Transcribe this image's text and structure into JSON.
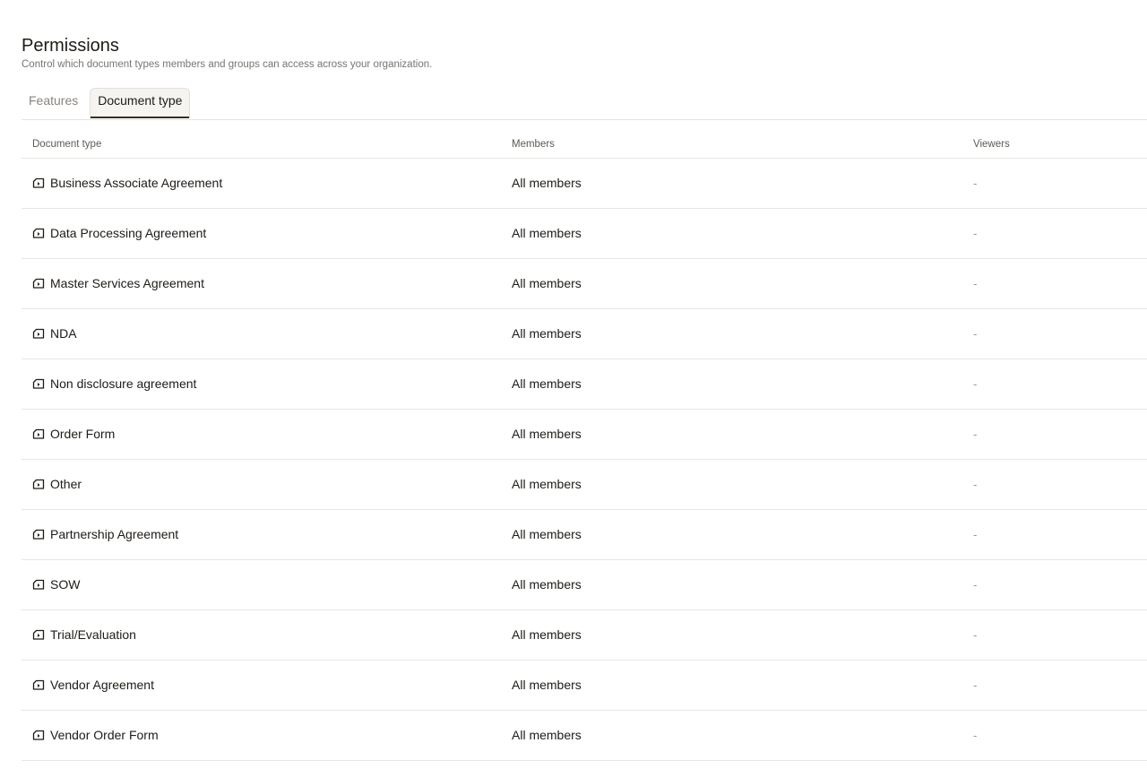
{
  "header": {
    "title": "Permissions",
    "subtitle": "Control which document types members and groups can access across your organization."
  },
  "tabs": [
    {
      "label": "Features",
      "active": false
    },
    {
      "label": "Document type",
      "active": true
    }
  ],
  "table": {
    "columns": [
      "Document type",
      "Members",
      "Viewers"
    ],
    "rows": [
      {
        "type": "Business Associate Agreement",
        "members": "All members",
        "viewers": "-"
      },
      {
        "type": "Data Processing Agreement",
        "members": "All members",
        "viewers": "-"
      },
      {
        "type": "Master Services Agreement",
        "members": "All members",
        "viewers": "-"
      },
      {
        "type": "NDA",
        "members": "All members",
        "viewers": "-"
      },
      {
        "type": "Non disclosure agreement",
        "members": "All members",
        "viewers": "-"
      },
      {
        "type": "Order Form",
        "members": "All members",
        "viewers": "-"
      },
      {
        "type": "Other",
        "members": "All members",
        "viewers": "-"
      },
      {
        "type": "Partnership Agreement",
        "members": "All members",
        "viewers": "-"
      },
      {
        "type": "SOW",
        "members": "All members",
        "viewers": "-"
      },
      {
        "type": "Trial/Evaluation",
        "members": "All members",
        "viewers": "-"
      },
      {
        "type": "Vendor Agreement",
        "members": "All members",
        "viewers": "-"
      },
      {
        "type": "Vendor Order Form",
        "members": "All members",
        "viewers": "-"
      }
    ],
    "row_icon": "document-type-icon"
  },
  "colors": {
    "text": "#1f1b17",
    "muted": "#7a746e",
    "border": "#e9e6e2",
    "active_tab_underline": "#3a2e24"
  }
}
